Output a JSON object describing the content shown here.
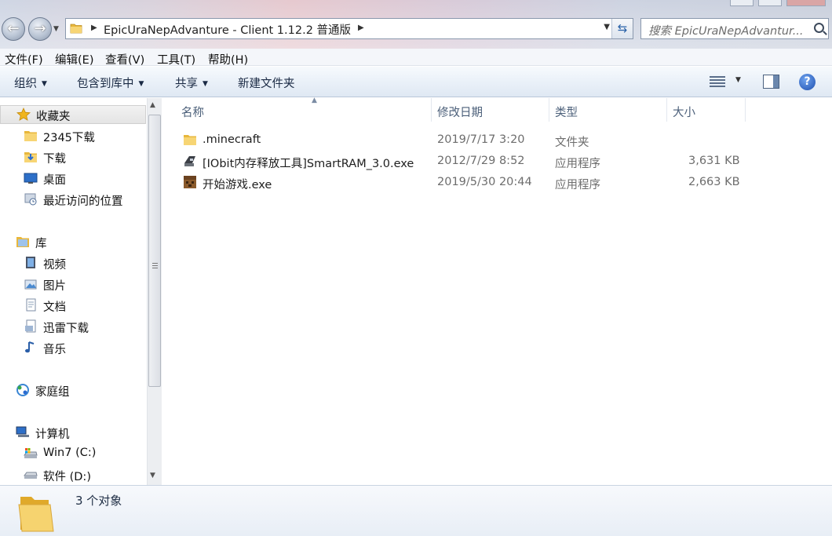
{
  "address_bar": {
    "path_text": "EpicUraNepAdvanture - Client 1.12.2 普通版",
    "search_placeholder": "搜索 EpicUraNepAdvantur..."
  },
  "menu": {
    "items": [
      "文件(F)",
      "编辑(E)",
      "查看(V)",
      "工具(T)",
      "帮助(H)"
    ]
  },
  "toolbar": {
    "organize": "组织",
    "include_library": "包含到库中",
    "share": "共享",
    "new_folder": "新建文件夹"
  },
  "sidebar": {
    "favorites": {
      "label": "收藏夹",
      "items": [
        "2345下载",
        "下载",
        "桌面",
        "最近访问的位置"
      ]
    },
    "libraries": {
      "label": "库",
      "items": [
        "视频",
        "图片",
        "文档",
        "迅雷下载",
        "音乐"
      ]
    },
    "homegroup": {
      "label": "家庭组"
    },
    "computer": {
      "label": "计算机",
      "items": [
        "Win7 (C:)",
        "软件 (D:)"
      ]
    }
  },
  "columns": {
    "name": "名称",
    "date": "修改日期",
    "type": "类型",
    "size": "大小"
  },
  "files": [
    {
      "name": ".minecraft",
      "date": "2019/7/17 3:20",
      "type": "文件夹",
      "size": "",
      "icon": "folder-icon"
    },
    {
      "name": "[IObit内存释放工具]SmartRAM_3.0.exe",
      "date": "2012/7/29 8:52",
      "type": "应用程序",
      "size": "3,631 KB",
      "icon": "app-icon"
    },
    {
      "name": "开始游戏.exe",
      "date": "2019/5/30 20:44",
      "type": "应用程序",
      "size": "2,663 KB",
      "icon": "minecraft-block-icon"
    }
  ],
  "status": {
    "text": "3 个对象"
  },
  "colors": {
    "folder": "#f2c94c",
    "selection_bg": "#e6e6e6",
    "header_text": "#4c607a",
    "command_bar": "#e9f0f8"
  }
}
